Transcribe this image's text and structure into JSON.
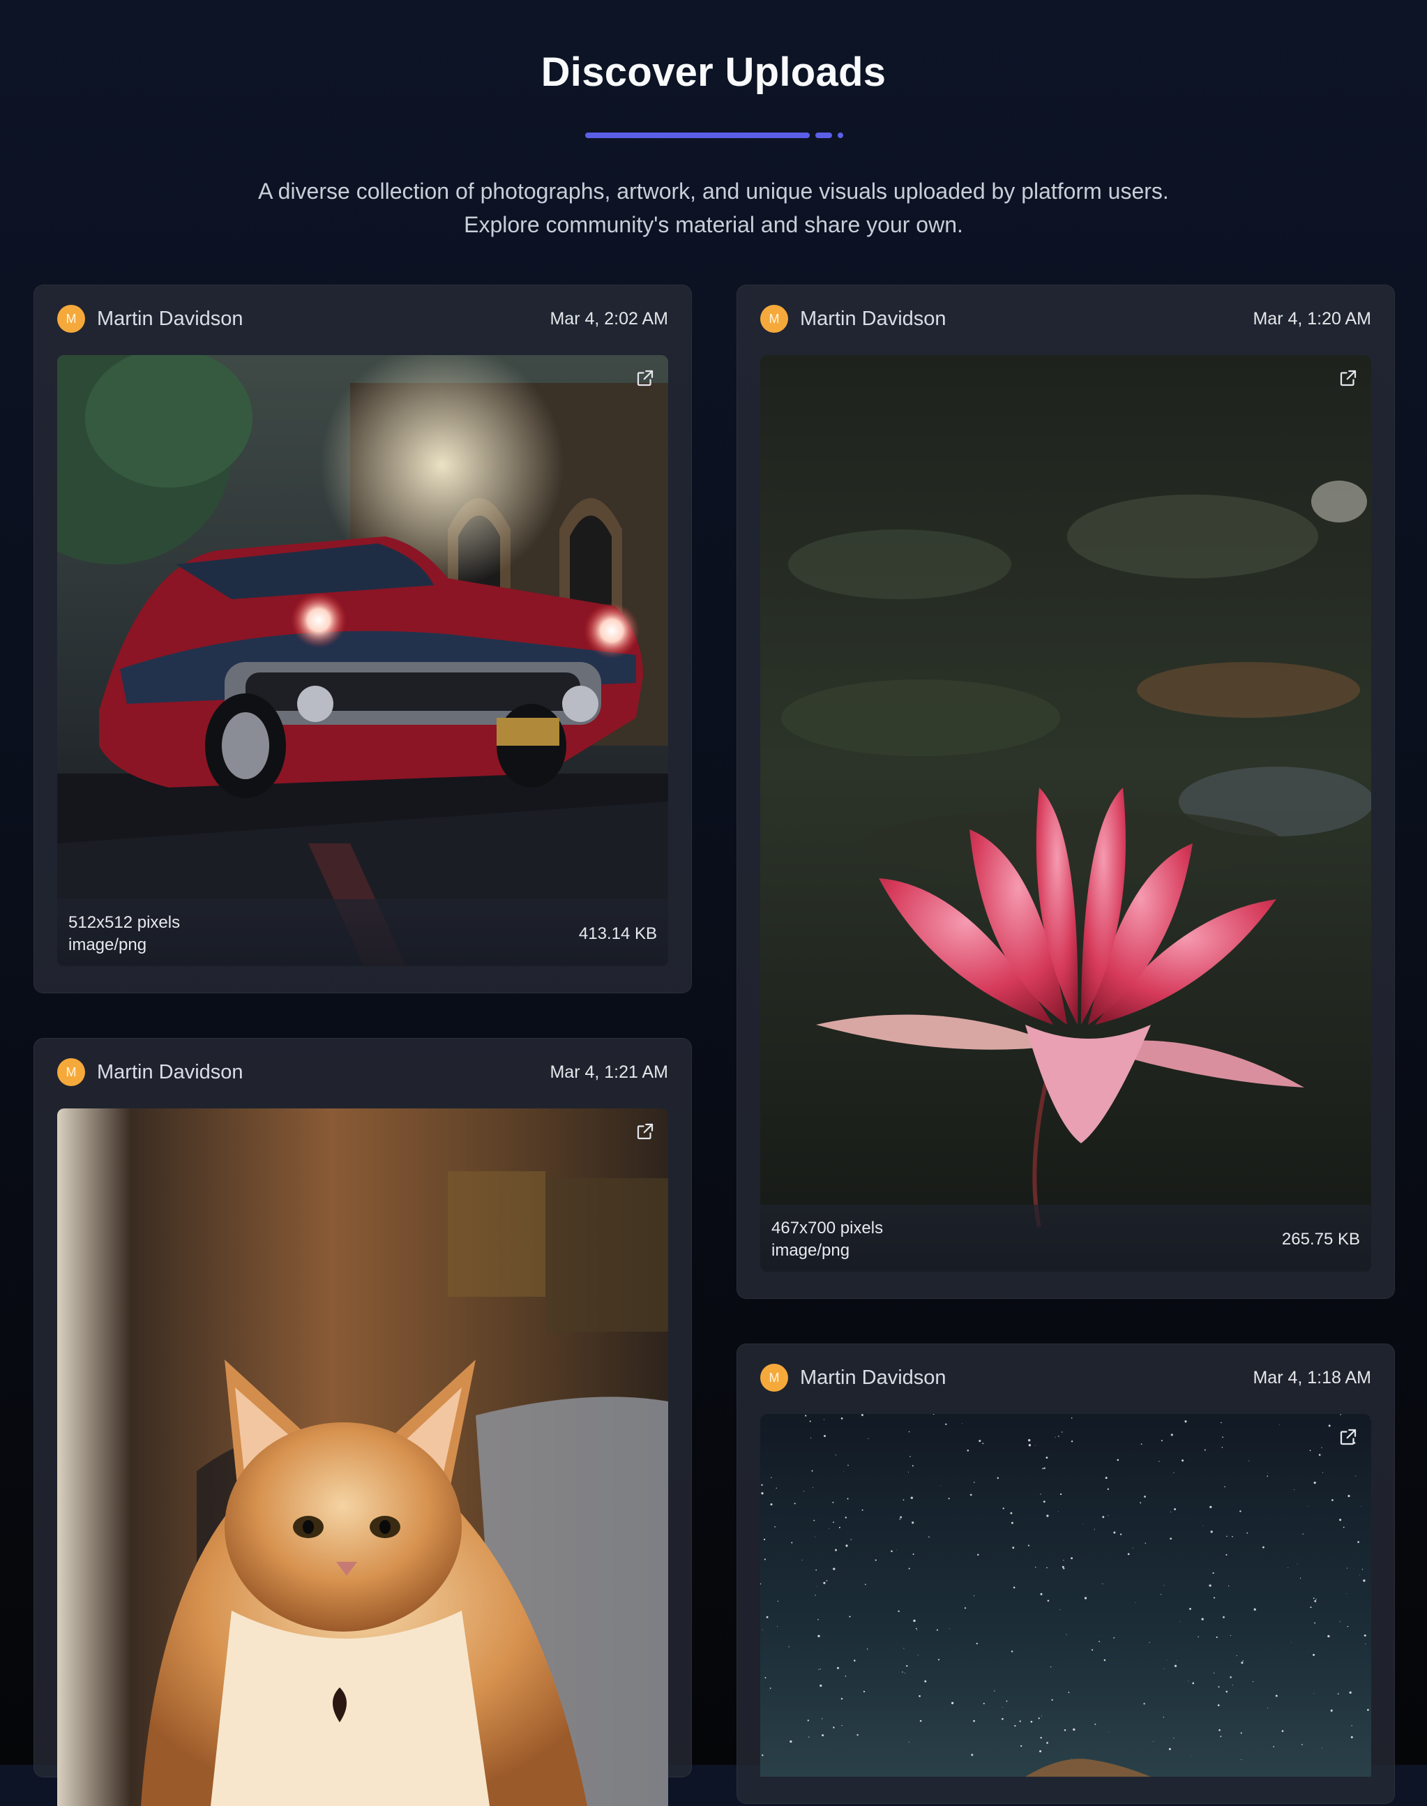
{
  "header": {
    "title": "Discover Uploads",
    "subtitle_line1": "A diverse collection of photographs, artwork, and unique visuals uploaded by platform users.",
    "subtitle_line2": "Explore community's material and share your own.",
    "accent_color": "#5b5fe8"
  },
  "cards": [
    {
      "author": "Martin Davidson",
      "avatar_initial": "M",
      "date": "Mar 4, 2:02 AM",
      "image_subject": "vintage car in rain",
      "dimensions": "512x512 pixels",
      "mime": "image/png",
      "size": "413.14 KB",
      "icon": "external-link-icon"
    },
    {
      "author": "Martin Davidson",
      "avatar_initial": "M",
      "date": "Mar 4, 1:20 AM",
      "image_subject": "pink lotus flower",
      "dimensions": "467x700 pixels",
      "mime": "image/png",
      "size": "265.75 KB",
      "icon": "external-link-icon"
    },
    {
      "author": "Martin Davidson",
      "avatar_initial": "M",
      "date": "Mar 4, 1:21 AM",
      "image_subject": "fluffy orange cat",
      "icon": "external-link-icon"
    },
    {
      "author": "Martin Davidson",
      "avatar_initial": "M",
      "date": "Mar 4, 1:18 AM",
      "image_subject": "starry night sky",
      "icon": "external-link-icon"
    }
  ],
  "colors": {
    "avatar": "#f6a93b",
    "card_bg": "#262a36",
    "page_bg": "#0d1426"
  }
}
